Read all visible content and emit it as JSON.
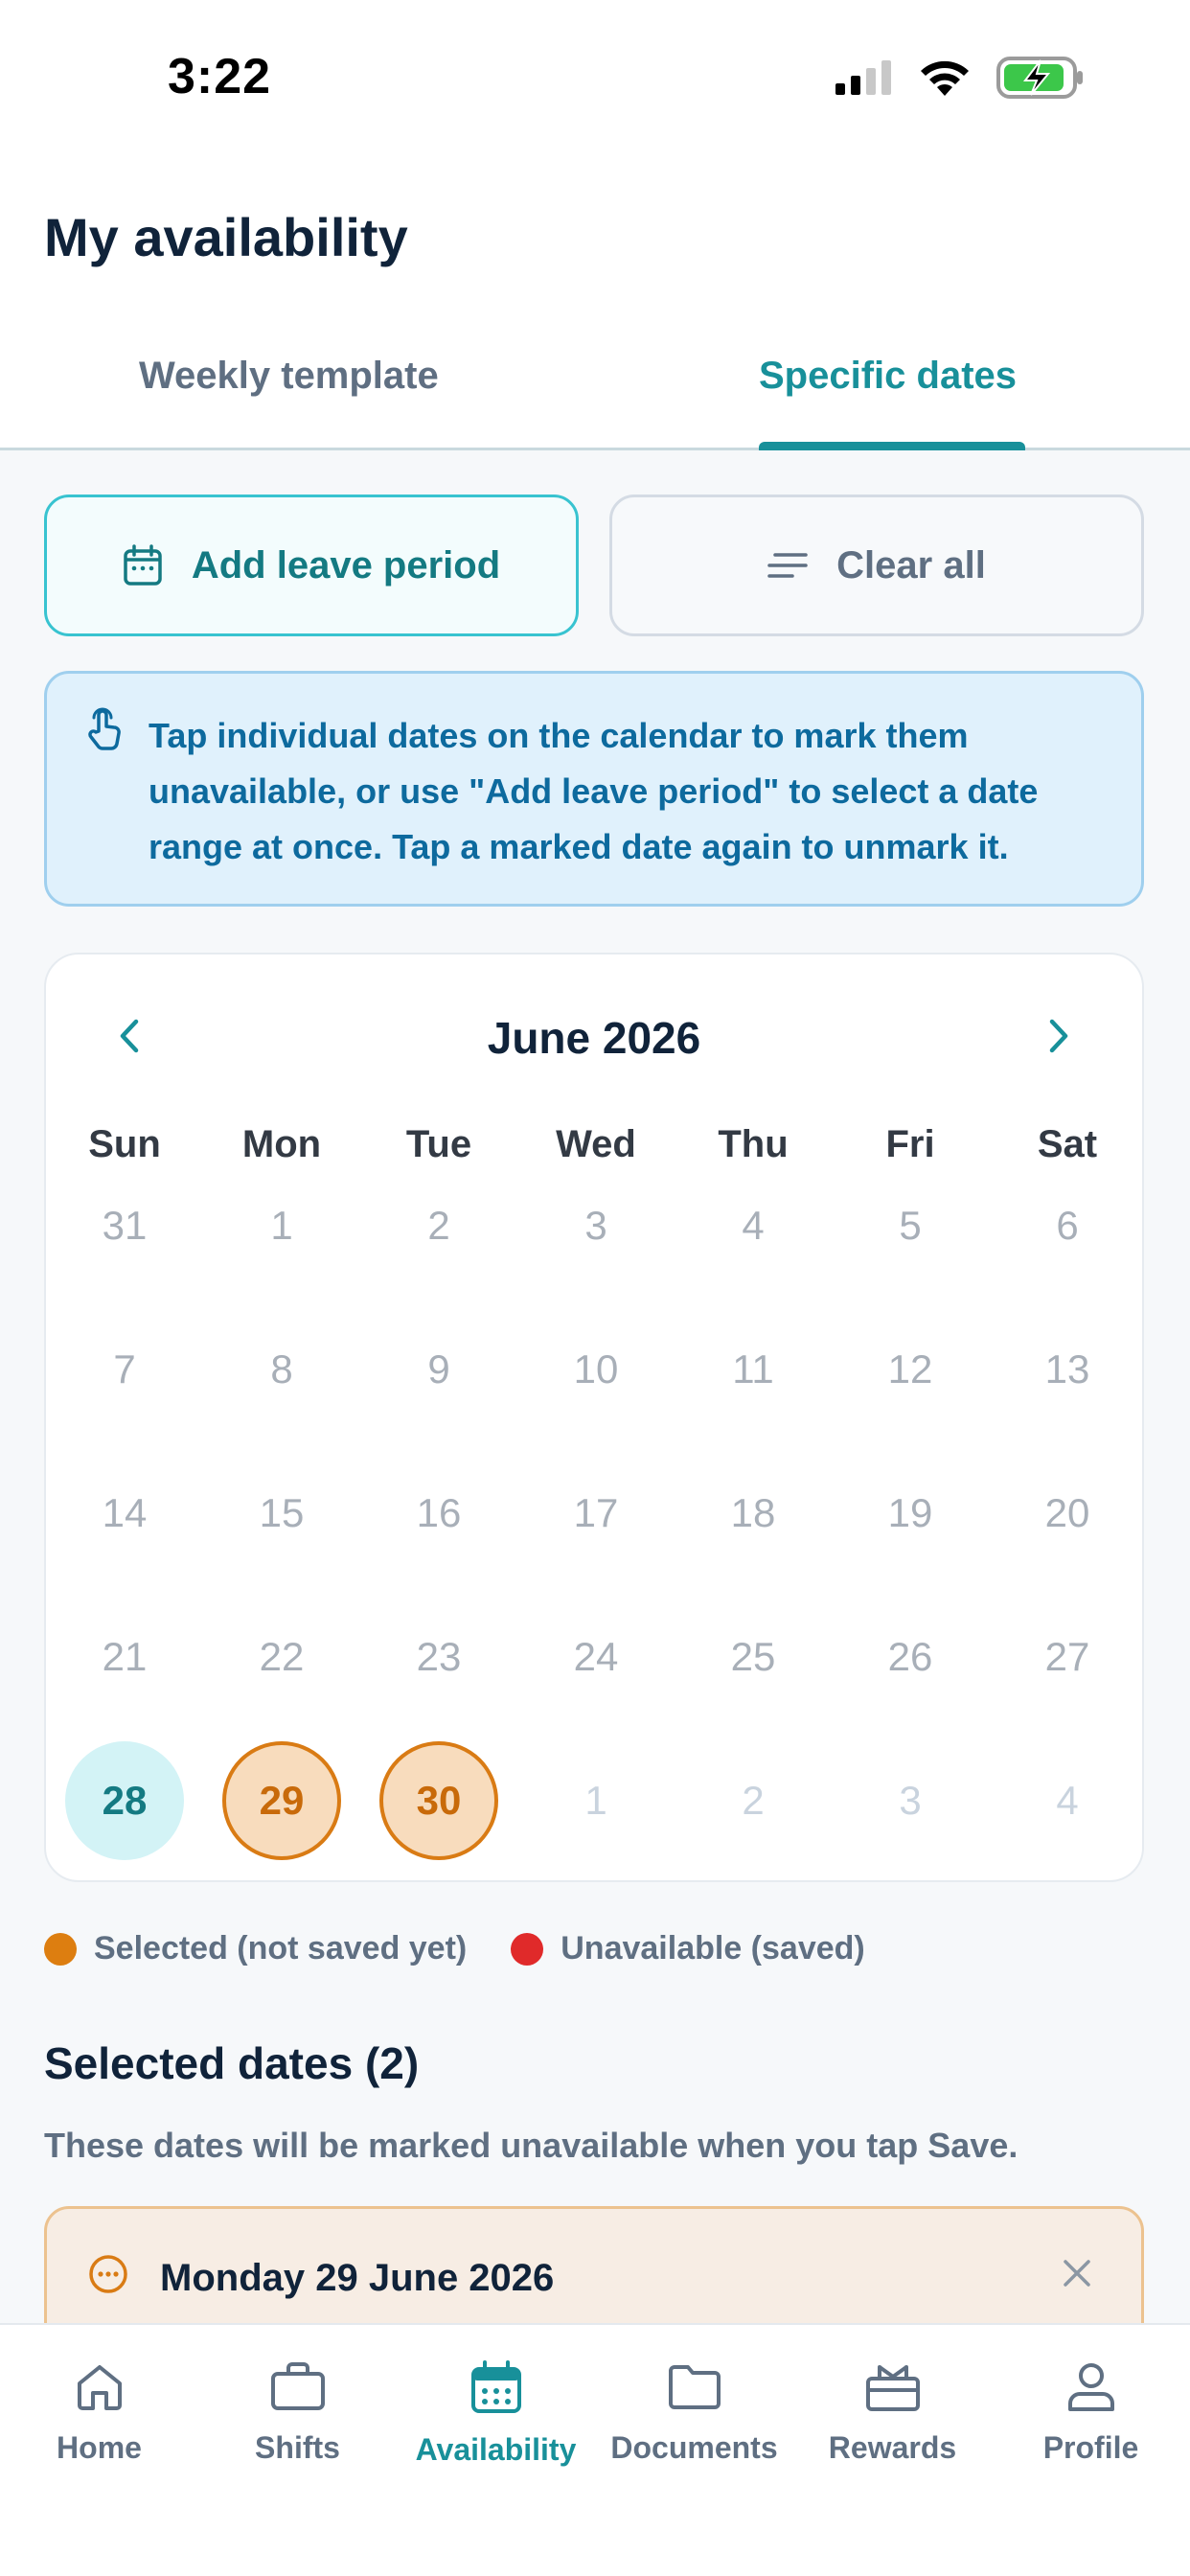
{
  "status": {
    "time": "3:22"
  },
  "header": {
    "title": "My availability"
  },
  "tabs": [
    {
      "label": "Weekly template",
      "active": false
    },
    {
      "label": "Specific dates",
      "active": true
    }
  ],
  "actions": {
    "add_leave": "Add leave period",
    "clear_all": "Clear all"
  },
  "info": {
    "text": "Tap individual dates on the calendar to mark them unavailable, or use \"Add leave period\" to select a date range at once. Tap a marked date again to unmark it."
  },
  "calendar": {
    "month": "June 2026",
    "weekdays": [
      "Sun",
      "Mon",
      "Tue",
      "Wed",
      "Thu",
      "Fri",
      "Sat"
    ],
    "weeks": [
      [
        "31",
        "1",
        "2",
        "3",
        "4",
        "5",
        "6"
      ],
      [
        "7",
        "8",
        "9",
        "10",
        "11",
        "12",
        "13"
      ],
      [
        "14",
        "15",
        "16",
        "17",
        "18",
        "19",
        "20"
      ],
      [
        "21",
        "22",
        "23",
        "24",
        "25",
        "26",
        "27"
      ],
      [
        "28",
        "29",
        "30",
        "1",
        "2",
        "3",
        "4"
      ]
    ],
    "today": "28",
    "selected": [
      "29",
      "30"
    ]
  },
  "legend": {
    "selected": "Selected (not saved yet)",
    "unavailable": "Unavailable (saved)"
  },
  "selection": {
    "title": "Selected dates (2)",
    "subtitle": "These dates will be marked unavailable when you tap Save.",
    "items": [
      "Monday 29 June 2026"
    ]
  },
  "nav": [
    {
      "label": "Home",
      "icon": "home-icon",
      "active": false
    },
    {
      "label": "Shifts",
      "icon": "briefcase-icon",
      "active": false
    },
    {
      "label": "Availability",
      "icon": "calendar-icon",
      "active": true
    },
    {
      "label": "Documents",
      "icon": "folder-icon",
      "active": false
    },
    {
      "label": "Rewards",
      "icon": "gift-icon",
      "active": false
    },
    {
      "label": "Profile",
      "icon": "user-icon",
      "active": false
    }
  ],
  "colors": {
    "accent": "#18909a",
    "selected": "#dd7e10",
    "unavailable": "#e02a2a",
    "info": "#0d6a9e"
  }
}
